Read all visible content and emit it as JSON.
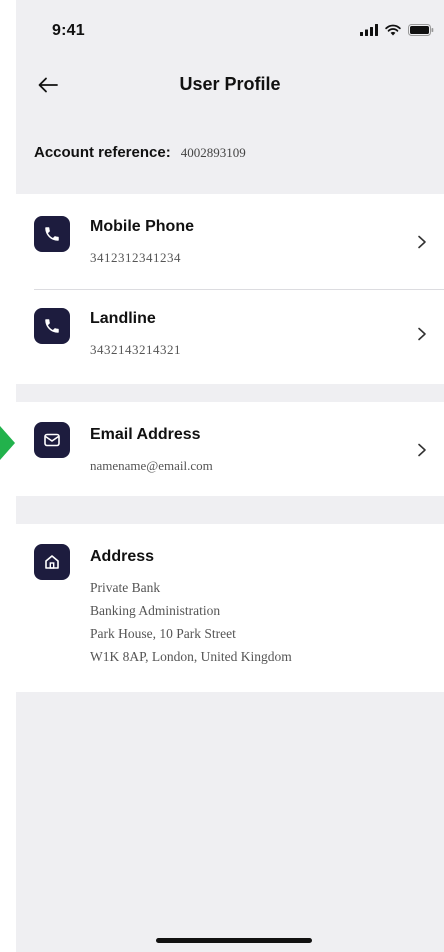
{
  "status_bar": {
    "time": "9:41"
  },
  "header": {
    "title": "User Profile"
  },
  "account": {
    "label": "Account reference:",
    "value": "4002893109"
  },
  "contacts": {
    "mobile": {
      "title": "Mobile Phone",
      "value": "3412312341234",
      "icon": "phone-icon"
    },
    "landline": {
      "title": "Landline",
      "value": "3432143214321",
      "icon": "phone-icon"
    },
    "email": {
      "title": "Email Address",
      "value": "namename@email.com",
      "icon": "mail-icon"
    }
  },
  "address": {
    "title": "Address",
    "icon": "home-icon",
    "lines": [
      "Private Bank",
      "Banking Administration",
      "Park House, 10 Park Street",
      "W1K 8AP, London, United Kingdom"
    ]
  },
  "colors": {
    "background": "#efeff2",
    "card": "#ffffff",
    "icon_bg": "#1d1c3e",
    "marker": "#22b24c"
  }
}
